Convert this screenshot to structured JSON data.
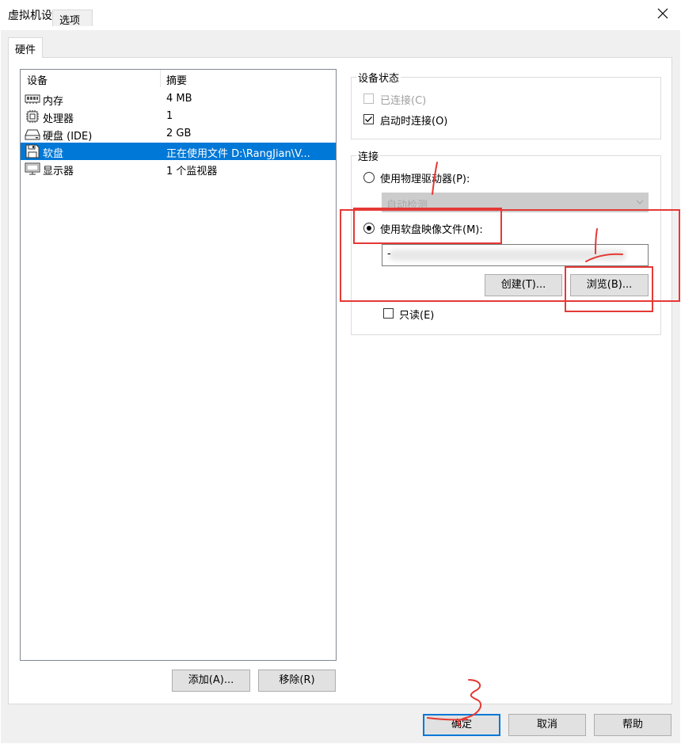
{
  "window": {
    "title": "虚拟机设置",
    "close_glyph": "✕"
  },
  "tabs": [
    {
      "label": "硬件",
      "active": true
    },
    {
      "label": "选项",
      "active": false
    }
  ],
  "device_list": {
    "columns": [
      "设备",
      "摘要"
    ],
    "rows": [
      {
        "icon": "memory-icon",
        "name": "内存",
        "summary": "4 MB",
        "selected": false
      },
      {
        "icon": "processor-icon",
        "name": "处理器",
        "summary": "1",
        "selected": false
      },
      {
        "icon": "hard-disk-icon",
        "name": "硬盘 (IDE)",
        "summary": "2 GB",
        "selected": false
      },
      {
        "icon": "floppy-icon",
        "name": "软盘",
        "summary": "正在使用文件 D:\\RangJian\\V...",
        "selected": true
      },
      {
        "icon": "monitor-icon",
        "name": "显示器",
        "summary": "1 个监视器",
        "selected": false
      }
    ]
  },
  "device_buttons": {
    "add": "添加(A)...",
    "remove": "移除(R)"
  },
  "device_status": {
    "label": "设备状态",
    "connected": {
      "label": "已连接(C)",
      "checked": false,
      "disabled": true
    },
    "connect_at_power_on": {
      "label": "启动时连接(O)",
      "checked": true
    }
  },
  "connection": {
    "label": "连接",
    "physical_drive": {
      "label": "使用物理驱动器(P):",
      "selected": false
    },
    "physical_drive_select": {
      "value": "自动检测",
      "disabled": true
    },
    "image_file": {
      "label": "使用软盘映像文件(M):",
      "selected": true
    },
    "image_path": "-",
    "create_button": "创建(T)...",
    "browse_button": "浏览(B)...",
    "read_only": {
      "label": "只读(E)",
      "checked": false
    }
  },
  "footer": {
    "ok": "确定",
    "cancel": "取消",
    "help": "帮助"
  },
  "colors": {
    "selection": "#0078d7",
    "annotation_red": "#e53935"
  }
}
